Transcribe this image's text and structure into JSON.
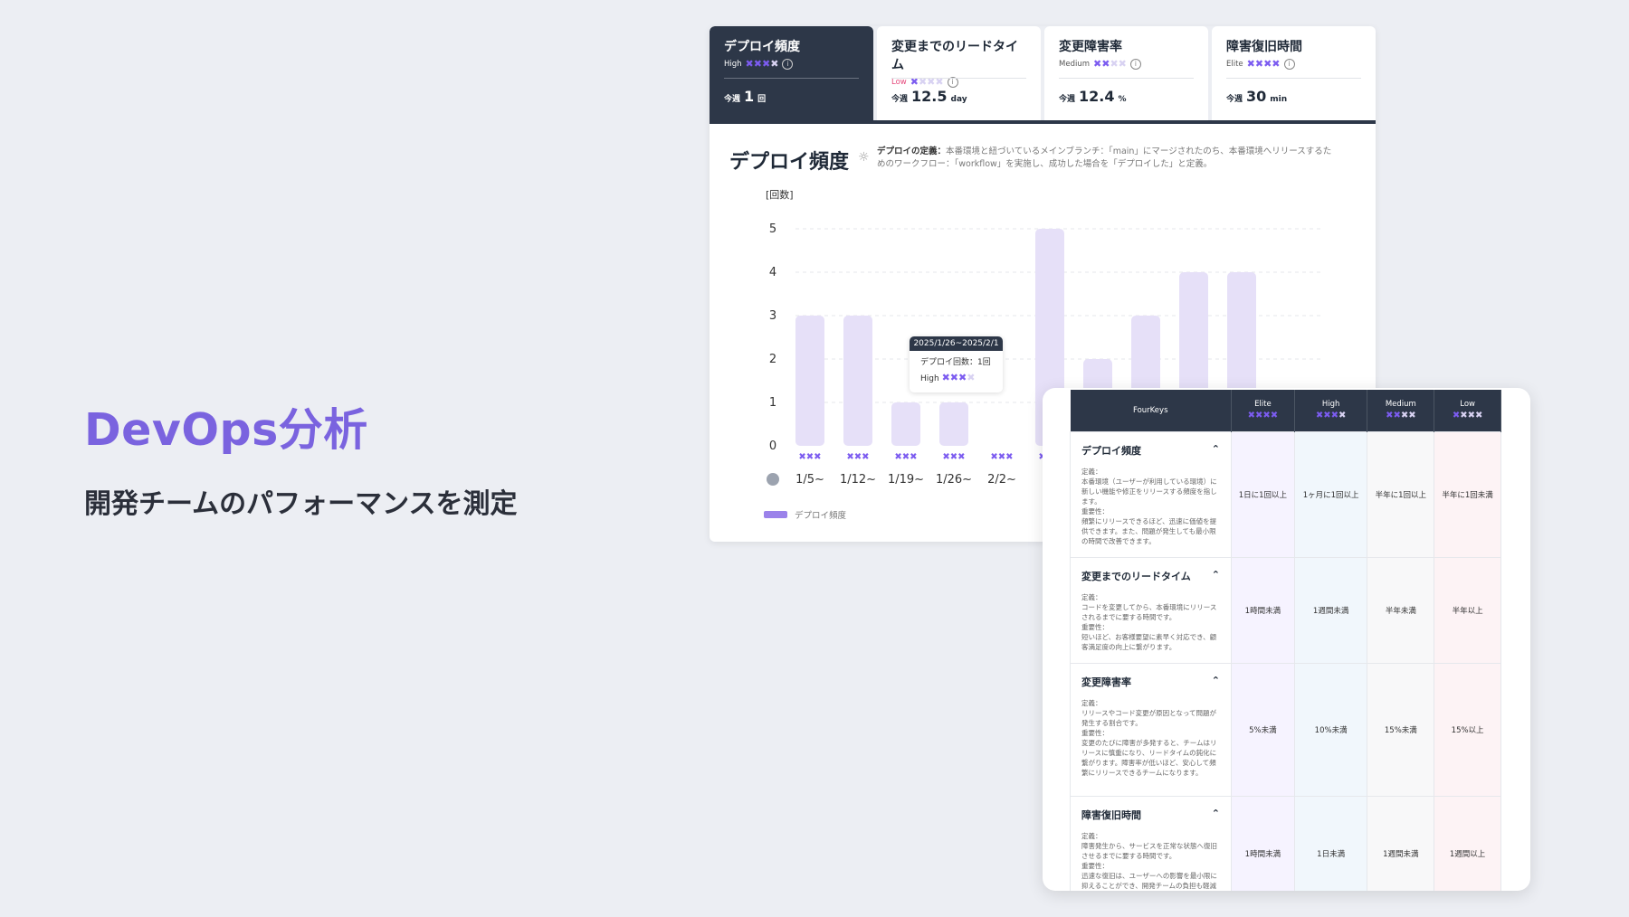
{
  "hero": {
    "title": "DevOps分析",
    "subtitle": "開発チームのパフォーマンスを測定"
  },
  "metrics": [
    {
      "name": "デプロイ頻度",
      "level": "High",
      "stars": 3,
      "prefix": "今週",
      "value": "1",
      "unit": "回",
      "active": true
    },
    {
      "name": "変更までのリードタイム",
      "level": "Low",
      "stars": 1,
      "prefix": "今週",
      "value": "12.5",
      "unit": "day",
      "active": false
    },
    {
      "name": "変更障害率",
      "level": "Medium",
      "stars": 2,
      "prefix": "今週",
      "value": "12.4",
      "unit": "%",
      "active": false
    },
    {
      "name": "障害復旧時間",
      "level": "Elite",
      "stars": 4,
      "prefix": "今週",
      "value": "30",
      "unit": "min",
      "active": false
    }
  ],
  "chart_panel": {
    "title": "デプロイ頻度",
    "desc_bold": "デプロイの定義：",
    "desc": "本番環境と紐づいているメインブランチ：「main」にマージされたのち、本番環境へリリースするためのワークフロー：「workflow」を実施し、成功した場合を「デプロイした」と定義。",
    "legend": "デプロイ頻度"
  },
  "tooltip": {
    "range": "2025/1/26~2025/2/1",
    "count_label": "デプロイ回数：1回",
    "level": "High"
  },
  "chart_data": {
    "type": "bar",
    "ylabel": "[回数]",
    "ylim": [
      0,
      5
    ],
    "yticks": [
      0,
      1,
      2,
      3,
      4,
      5
    ],
    "categories": [
      "1/5~",
      "1/12~",
      "1/19~",
      "1/26~",
      "2/2~",
      "",
      "",
      "",
      "",
      ""
    ],
    "values": [
      3,
      3,
      1,
      1,
      0,
      5,
      2,
      3,
      4,
      4
    ],
    "series": [
      {
        "name": "デプロイ頻度",
        "values": [
          3,
          3,
          1,
          1,
          0,
          5,
          2,
          3,
          4,
          4
        ]
      }
    ],
    "grid": true,
    "legend": "bottom-left",
    "bar_color": "#e6e0f8"
  },
  "fourkeys_table": {
    "header": "FourKeys",
    "levels": [
      {
        "name": "Elite",
        "stars": 4
      },
      {
        "name": "High",
        "stars": 3
      },
      {
        "name": "Medium",
        "stars": 2
      },
      {
        "name": "Low",
        "stars": 1
      }
    ],
    "rows": [
      {
        "name": "デプロイ頻度",
        "text": "定義：\n本番環境（ユーザーが利用している環境）に新しい機能や修正をリリースする頻度を指します。\n重要性：\n頻繁にリリースできるほど、迅速に価値を提供できます。また、問題が発生しても最小限の時間で改善できます。",
        "cells": [
          "1日に1回以上",
          "1ヶ月に1回以上",
          "半年に1回以上",
          "半年に1回未満"
        ]
      },
      {
        "name": "変更までのリードタイム",
        "text": "定義：\nコードを変更してから、本番環境にリリースされるまでに要する時間です。\n重要性：\n短いほど、お客様要望に素早く対応でき、顧客満足度の向上に繋がります。",
        "cells": [
          "1時間未満",
          "1週間未満",
          "半年未満",
          "半年以上"
        ]
      },
      {
        "name": "変更障害率",
        "text": "定義：\nリリースやコード変更が原因となって問題が発生する割合です。\n重要性：\n変更のたびに障害が多発すると、チームはリリースに慎重になり、リードタイムの鈍化に繋がります。障害率が低いほど、安心して頻繁にリリースできるチームになります。",
        "cells": [
          "5%未満",
          "10%未満",
          "15%未満",
          "15%以上"
        ]
      },
      {
        "name": "障害復旧時間",
        "text": "定義：\n障害発生から、サービスを正常な状態へ復旧させるまでに要する時間です。\n重要性：\n迅速な復旧は、ユーザーへの影響を最小限に抑えることができ、開発チームの負担も軽減します。",
        "cells": [
          "1時間未満",
          "1日未満",
          "1週間未満",
          "1週間以上"
        ]
      }
    ]
  },
  "colors": {
    "accent": "#7a63df",
    "dark": "#2d3748",
    "star": "#7c5cf0",
    "bar": "#e6e0f8",
    "low": "#e5487b"
  }
}
